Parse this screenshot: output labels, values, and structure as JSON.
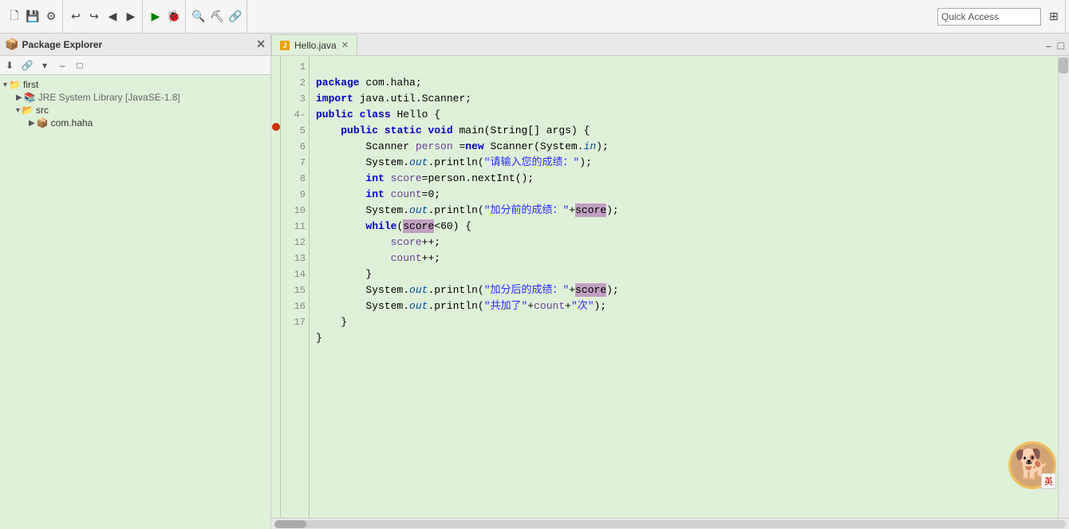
{
  "toolbar": {
    "quick_access_placeholder": "Quick Access"
  },
  "package_explorer": {
    "title": "Package Explorer",
    "tree": [
      {
        "id": "first",
        "label": "first",
        "indent": 0,
        "icon": "project",
        "expanded": true
      },
      {
        "id": "jre",
        "label": "JRE System Library [JavaSE-1.8]",
        "indent": 1,
        "icon": "library",
        "expanded": false
      },
      {
        "id": "src",
        "label": "src",
        "indent": 1,
        "icon": "folder",
        "expanded": true
      },
      {
        "id": "com.haha",
        "label": "com.haha",
        "indent": 2,
        "icon": "package",
        "expanded": false
      }
    ]
  },
  "editor": {
    "tab_label": "Hello.java",
    "lines": [
      {
        "num": 1,
        "content": "package com.haha;"
      },
      {
        "num": 2,
        "content": "import java.util.Scanner;"
      },
      {
        "num": 3,
        "content": "public class Hello {"
      },
      {
        "num": 4,
        "content": "    public static void main(String[] args) {"
      },
      {
        "num": 5,
        "content": "        Scanner person =new Scanner(System.in);"
      },
      {
        "num": 6,
        "content": "        System.out.println(\"请输入您的成绩：\");"
      },
      {
        "num": 7,
        "content": "        int score=person.nextInt();"
      },
      {
        "num": 8,
        "content": "        int count=0;"
      },
      {
        "num": 9,
        "content": "        System.out.println(\"加分前的成绩：\"+score);"
      },
      {
        "num": 10,
        "content": "        while(score<60) {"
      },
      {
        "num": 11,
        "content": "            score++;"
      },
      {
        "num": 12,
        "content": "            count++;"
      },
      {
        "num": 13,
        "content": "        }"
      },
      {
        "num": 14,
        "content": "        System.out.println(\"加分后的成绩：\"+score);"
      },
      {
        "num": 15,
        "content": "        System.out.println(\"共加了\"+count+\"次\");"
      },
      {
        "num": 16,
        "content": "    }"
      },
      {
        "num": 17,
        "content": "}"
      }
    ]
  }
}
